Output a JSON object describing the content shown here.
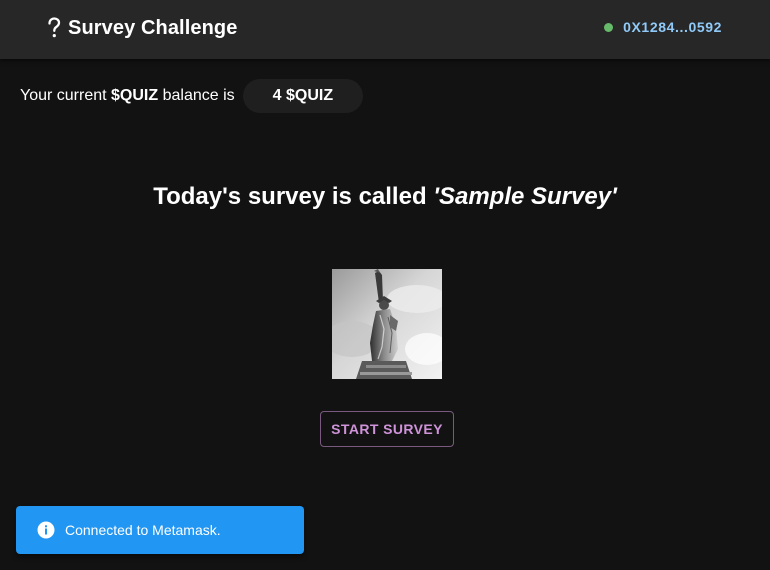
{
  "header": {
    "title": "Survey Challenge",
    "brand_icon": "question-mark-icon",
    "wallet_address": "0X1284...0592",
    "wallet_status_color": "#66bb6a",
    "accent_color": "#90caf9"
  },
  "balance": {
    "prefix": "Your current",
    "token": "$QUIZ",
    "suffix": "balance is",
    "amount": "4 $QUIZ"
  },
  "survey": {
    "title_prefix": "Today's survey is called",
    "name": "'Sample Survey'",
    "image": "statue-of-liberty-photo",
    "start_label": "START SURVEY",
    "start_color": "#ce93d8"
  },
  "notification": {
    "icon": "info-icon",
    "message": "Connected to Metamask.",
    "color": "#2196f3"
  }
}
